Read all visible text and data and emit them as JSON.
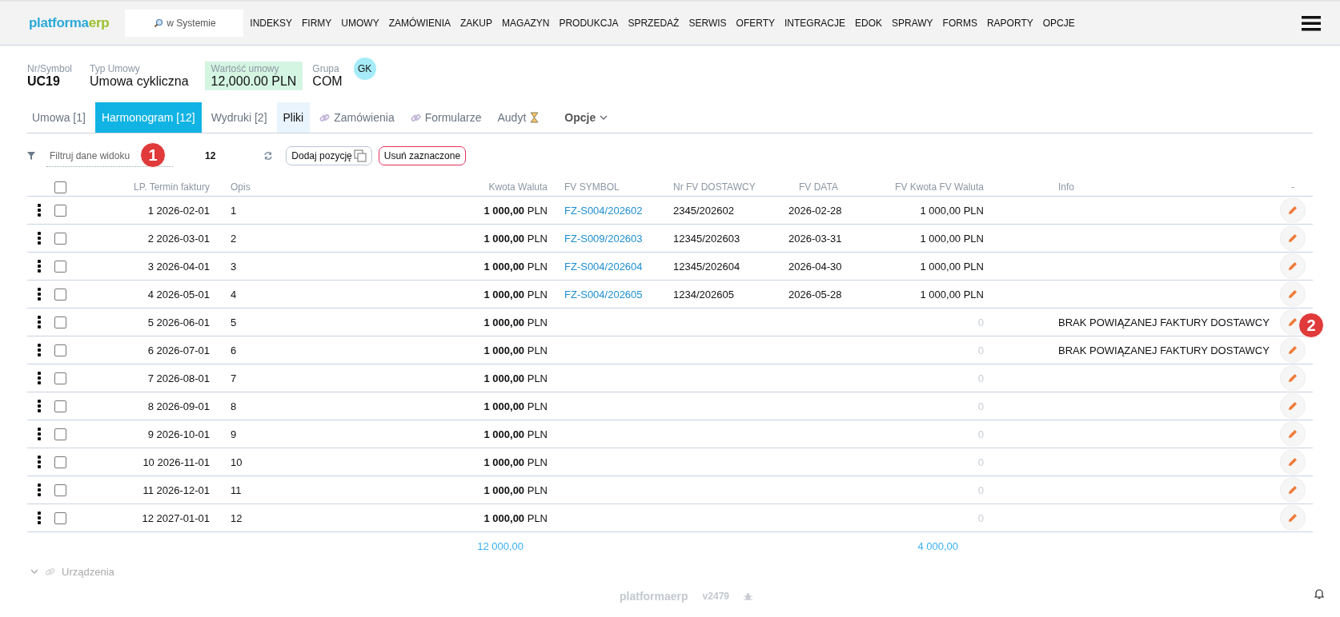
{
  "navbar": {
    "logo": {
      "main": "platforma",
      "accent": "erp"
    },
    "search": {
      "placeholder": "w Systemie"
    },
    "menu": [
      "INDEKSY",
      "FIRMY",
      "UMOWY",
      "ZAMÓWIENIA",
      "ZAKUP",
      "MAGAZYN",
      "PRODUKCJA",
      "SPRZEDAŻ",
      "SERWIS",
      "OFERTY",
      "INTEGRACJE",
      "EDOK",
      "SPRAWY",
      "FORMS",
      "RAPORTY",
      "OPCJE"
    ]
  },
  "contract": [
    {
      "label": "Nr/Symbol",
      "value": "UC19",
      "kind": "bold"
    },
    {
      "label": "Typ Umowy",
      "value": "Umowa cykliczna",
      "kind": "plain"
    },
    {
      "label": "Wartość umowy",
      "value": "12,000.00 PLN",
      "kind": "highlight"
    },
    {
      "label": "Grupa",
      "value": "COM",
      "kind": "plain"
    }
  ],
  "avatar": "GK",
  "tabs": [
    {
      "label": "Umowa [1]",
      "selected": false,
      "highlighted": false
    },
    {
      "label": "Harmonogram [12]",
      "selected": true,
      "highlighted": false
    },
    {
      "label": "Wydruki [2]",
      "selected": false,
      "highlighted": false
    },
    {
      "label": "Pliki",
      "selected": false,
      "highlighted": true
    },
    {
      "label": "Zamówienia",
      "selected": false,
      "highlighted": false,
      "kind": "link"
    },
    {
      "label": "Formularze",
      "selected": false,
      "highlighted": false,
      "kind": "link"
    },
    {
      "label": "Audyt",
      "selected": false,
      "highlighted": false,
      "kind": "pending"
    },
    {
      "label": "Opcje",
      "selected": false,
      "highlighted": false,
      "kind": "dropdown"
    }
  ],
  "toolbar": {
    "filter_placeholder": "Filtruj dane widoku",
    "count": "12",
    "add_button": "Dodaj pozycję",
    "delete_button": "Usuń zaznaczone"
  },
  "annotations": [
    {
      "label": "1"
    },
    {
      "label": "2"
    }
  ],
  "table": {
    "columns": [
      "LP. Termin faktury",
      "Opis",
      "Kwota Waluta",
      "FV SYMBOL",
      "Nr FV DOSTAWCY",
      "FV DATA",
      "FV Kwota FV Waluta",
      "Info",
      "-"
    ],
    "header_checked": false,
    "rows": [
      {
        "checked": false,
        "term": "1 2026-02-01",
        "opis": "1",
        "amount": "**1 000,00** PLN",
        "fv_symbol": "FZ-S004/202602",
        "supplier_no": "2345/202602",
        "fv_date": "2026-02-28",
        "fv_amount": "1 000,00 PLN",
        "fv_amount_empty": false
      },
      {
        "checked": false,
        "term": "2 2026-03-01",
        "opis": "2",
        "amount": "**1 000,00** PLN",
        "fv_symbol": "FZ-S009/202603",
        "supplier_no": "12345/202603",
        "fv_date": "2026-03-31",
        "fv_amount": "1 000,00 PLN",
        "fv_amount_empty": false
      },
      {
        "checked": false,
        "term": "3 2026-04-01",
        "opis": "3",
        "amount": "**1 000,00** PLN",
        "fv_symbol": "FZ-S004/202604",
        "supplier_no": "12345/202604",
        "fv_date": "2026-04-30",
        "fv_amount": "1 000,00 PLN",
        "fv_amount_empty": false
      },
      {
        "checked": false,
        "term": "4 2026-05-01",
        "opis": "4",
        "amount": "**1 000,00** PLN",
        "fv_symbol": "FZ-S004/202605",
        "supplier_no": "1234/202605",
        "fv_date": "2026-05-28",
        "fv_amount": "1 000,00 PLN",
        "fv_amount_empty": false
      },
      {
        "checked": false,
        "term": "5 2026-06-01",
        "opis": "5",
        "amount": "**1 000,00** PLN",
        "fv_amount": "0",
        "fv_amount_empty": true,
        "info": "BRAK POWIĄZANEJ FAKTURY DOSTAWCY"
      },
      {
        "checked": false,
        "term": "6 2026-07-01",
        "opis": "6",
        "amount": "**1 000,00** PLN",
        "fv_amount": "0",
        "fv_amount_empty": true,
        "info": "BRAK POWIĄZANEJ FAKTURY DOSTAWCY"
      },
      {
        "checked": false,
        "term": "7 2026-08-01",
        "opis": "7",
        "amount": "**1 000,00** PLN",
        "fv_amount": "0",
        "fv_amount_empty": true
      },
      {
        "checked": false,
        "term": "8 2026-09-01",
        "opis": "8",
        "amount": "**1 000,00** PLN",
        "fv_amount": "0",
        "fv_amount_empty": true
      },
      {
        "checked": false,
        "term": "9 2026-10-01",
        "opis": "9",
        "amount": "**1 000,00** PLN",
        "fv_amount": "0",
        "fv_amount_empty": true
      },
      {
        "checked": false,
        "term": "10 2026-11-01",
        "opis": "10",
        "amount": "**1 000,00** PLN",
        "fv_amount": "0",
        "fv_amount_empty": true
      },
      {
        "checked": false,
        "term": "11 2026-12-01",
        "opis": "11",
        "amount": "**1 000,00** PLN",
        "fv_amount": "0",
        "fv_amount_empty": true
      },
      {
        "checked": false,
        "term": "12 2027-01-01",
        "opis": "12",
        "amount": "**1 000,00** PLN",
        "fv_amount": "0",
        "fv_amount_empty": true
      }
    ],
    "totals": {
      "amount": "12 000,00",
      "fv_amount": "4 000,00"
    }
  },
  "section": {
    "label": "Urządzenia",
    "expanded": false
  },
  "footer": {
    "logo": {
      "main": "platforma",
      "accent": "erp"
    },
    "version": "v2479"
  }
}
